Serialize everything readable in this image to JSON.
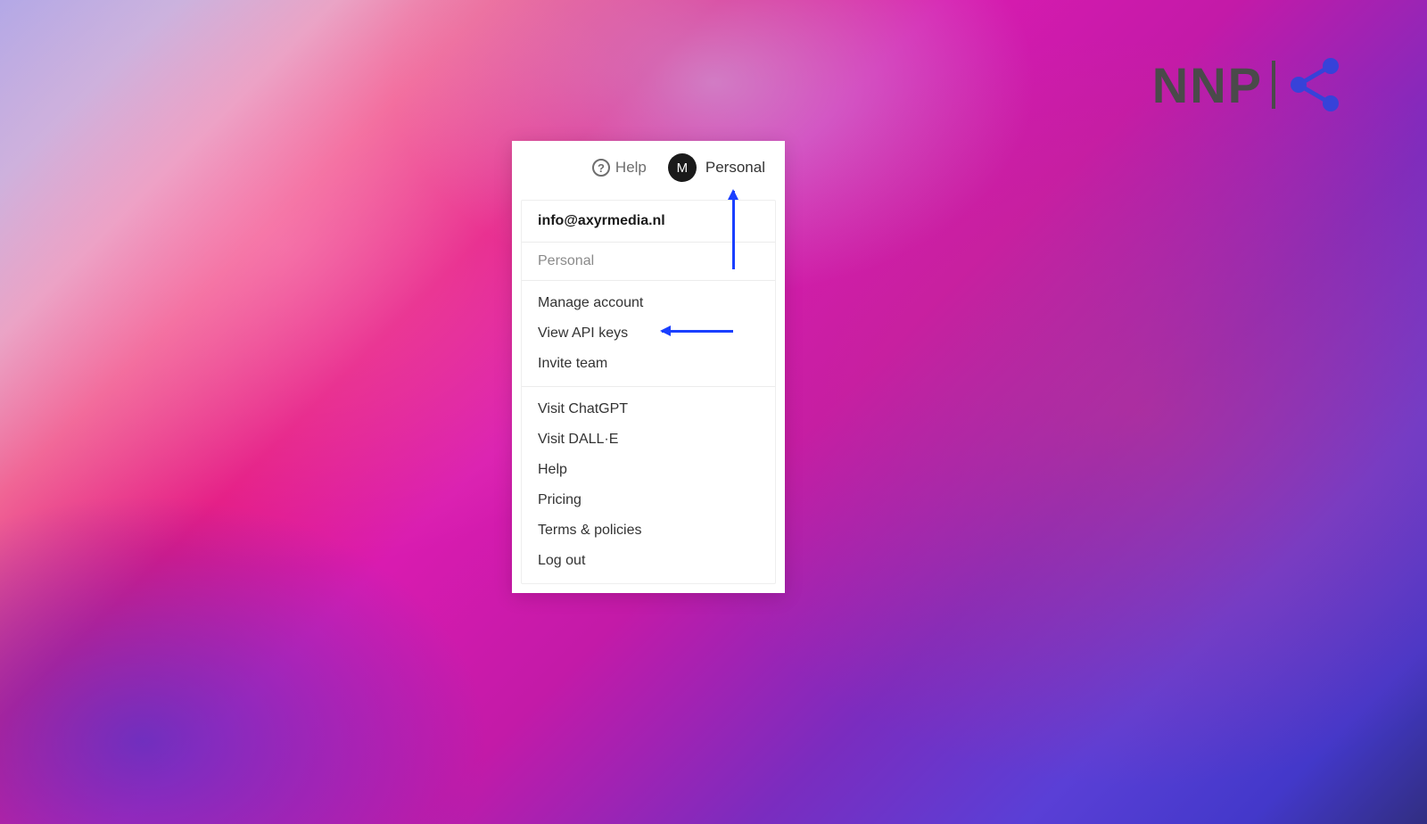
{
  "topbar": {
    "help_label": "Help",
    "avatar_initial": "M",
    "personal_label": "Personal"
  },
  "dropdown": {
    "email": "info@axyrmedia.nl",
    "workspace_label": "Personal",
    "group_account": [
      "Manage account",
      "View API keys",
      "Invite team"
    ],
    "group_links": [
      "Visit ChatGPT",
      "Visit DALL·E",
      "Help",
      "Pricing",
      "Terms & policies",
      "Log out"
    ]
  },
  "watermark": {
    "text": "NNP"
  },
  "colors": {
    "annotation_arrow": "#1a3fff",
    "share_icon": "#3742d9"
  }
}
